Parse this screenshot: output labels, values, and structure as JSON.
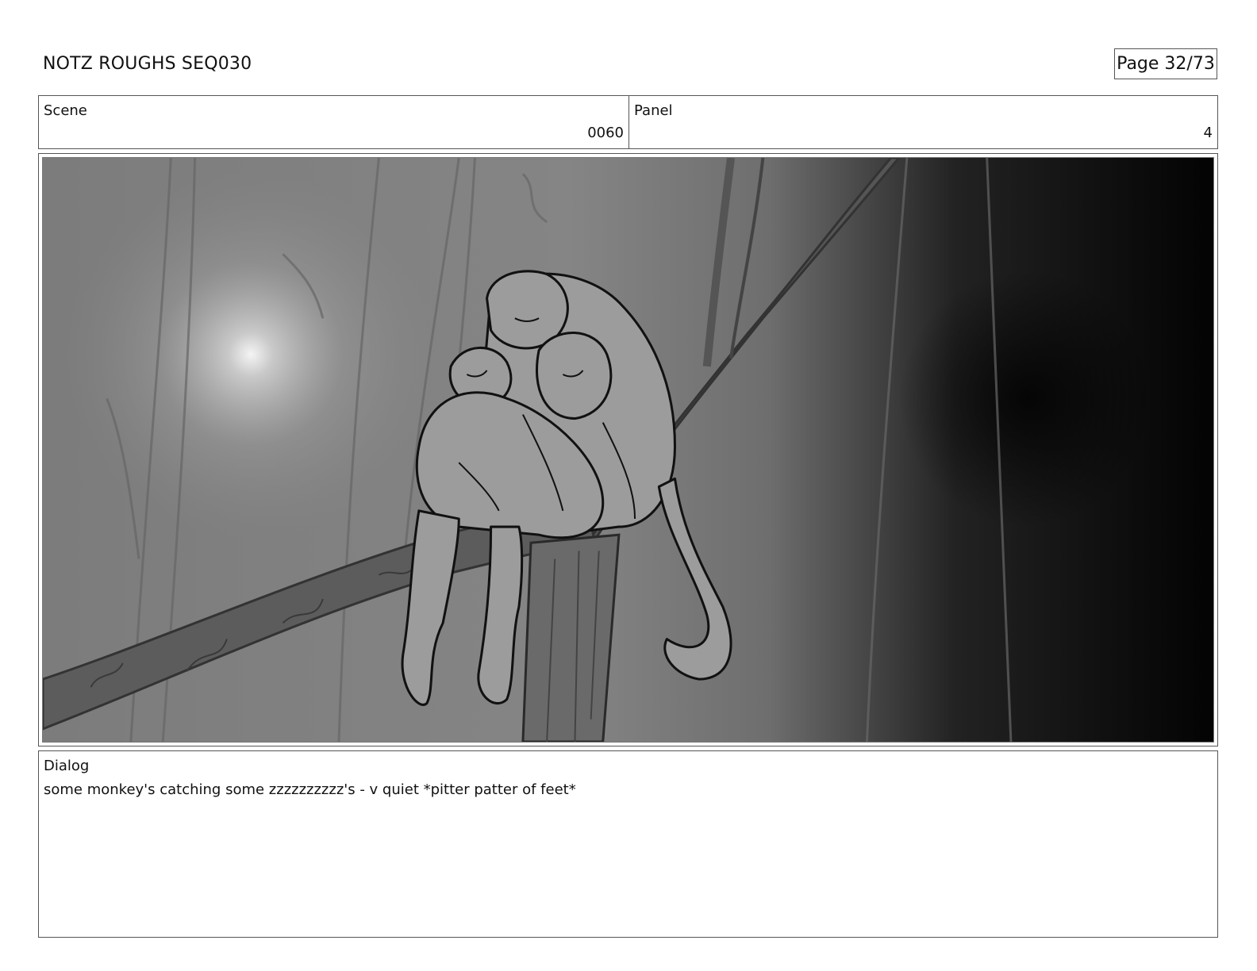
{
  "header": {
    "title": "NOTZ ROUGHS SEQ030",
    "page": "Page 32/73"
  },
  "info": {
    "scene_label": "Scene",
    "scene_value": "0060",
    "panel_label": "Panel",
    "panel_value": "4"
  },
  "panel_image": {
    "subject": "rough-sketch-monkeys-sleeping-on-branch"
  },
  "dialog": {
    "label": "Dialog",
    "text": "some monkey's catching some zzzzzzzzzz's - v quiet *pitter patter of feet*"
  }
}
